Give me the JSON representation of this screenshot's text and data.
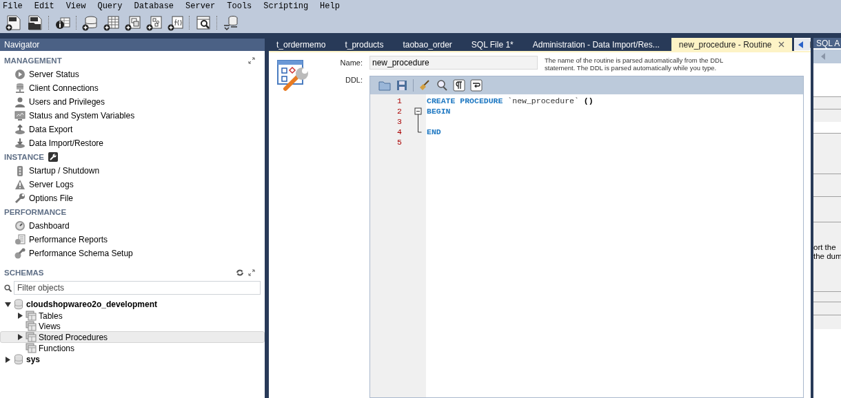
{
  "menu": [
    "File",
    "Edit",
    "View",
    "Query",
    "Database",
    "Server",
    "Tools",
    "Scripting",
    "Help"
  ],
  "navigator": {
    "title": "Navigator",
    "sections": [
      {
        "title": "MANAGEMENT",
        "items": [
          "Server Status",
          "Client Connections",
          "Users and Privileges",
          "Status and System Variables",
          "Data Export",
          "Data Import/Restore"
        ]
      },
      {
        "title": "INSTANCE",
        "items": [
          "Startup / Shutdown",
          "Server Logs",
          "Options File"
        ]
      },
      {
        "title": "PERFORMANCE",
        "items": [
          "Dashboard",
          "Performance Reports",
          "Performance Schema Setup"
        ]
      }
    ],
    "schemas": {
      "title": "SCHEMAS",
      "filter_placeholder": "Filter objects",
      "tree": [
        {
          "label": "cloudshopwareo2o_development",
          "kind": "schema",
          "expanded": true,
          "selected": false,
          "children": [
            {
              "label": "Tables",
              "kind": "group",
              "expanded": false,
              "selected": false
            },
            {
              "label": "Views",
              "kind": "group",
              "selected": false
            },
            {
              "label": "Stored Procedures",
              "kind": "group",
              "expanded": false,
              "selected": true
            },
            {
              "label": "Functions",
              "kind": "group",
              "selected": false
            }
          ]
        },
        {
          "label": "sys",
          "kind": "schema",
          "expanded": false,
          "selected": false
        }
      ]
    }
  },
  "tabs": [
    {
      "label": "t_ordermemo",
      "selected": false
    },
    {
      "label": "t_products",
      "selected": false
    },
    {
      "label": "taobao_order",
      "selected": false
    },
    {
      "label": "SQL File 1*",
      "selected": false
    },
    {
      "label": "Administration - Data Import/Res...",
      "selected": false
    },
    {
      "label": "new_procedure - Routine",
      "selected": true
    }
  ],
  "routine": {
    "name_label": "Name:",
    "name_value": "new_procedure",
    "hint": "The name of the routine is parsed automatically from the DDL statement. The DDL is parsed automatically while you type.",
    "ddl_label": "DDL:",
    "lines": [
      {
        "number": "1",
        "tokens": [
          {
            "text": "CREATE PROCEDURE",
            "kind": "keyword"
          },
          {
            "text": " `new_procedure` ",
            "kind": "identifier"
          },
          {
            "text": "()",
            "kind": "plain"
          }
        ]
      },
      {
        "number": "2",
        "fold_open": true,
        "fold_close": false,
        "tokens": [
          {
            "text": "BEGIN",
            "kind": "keyword"
          }
        ]
      },
      {
        "number": "3",
        "fold_open": false,
        "fold_close": false
      },
      {
        "number": "4",
        "fold_open": false,
        "fold_close": true,
        "tokens": [
          {
            "text": "END",
            "kind": "keyword"
          }
        ]
      },
      {
        "number": "5"
      }
    ]
  },
  "side_panel": {
    "tab": "SQL A",
    "text_lines": [
      "ort the",
      "the dum"
    ]
  }
}
